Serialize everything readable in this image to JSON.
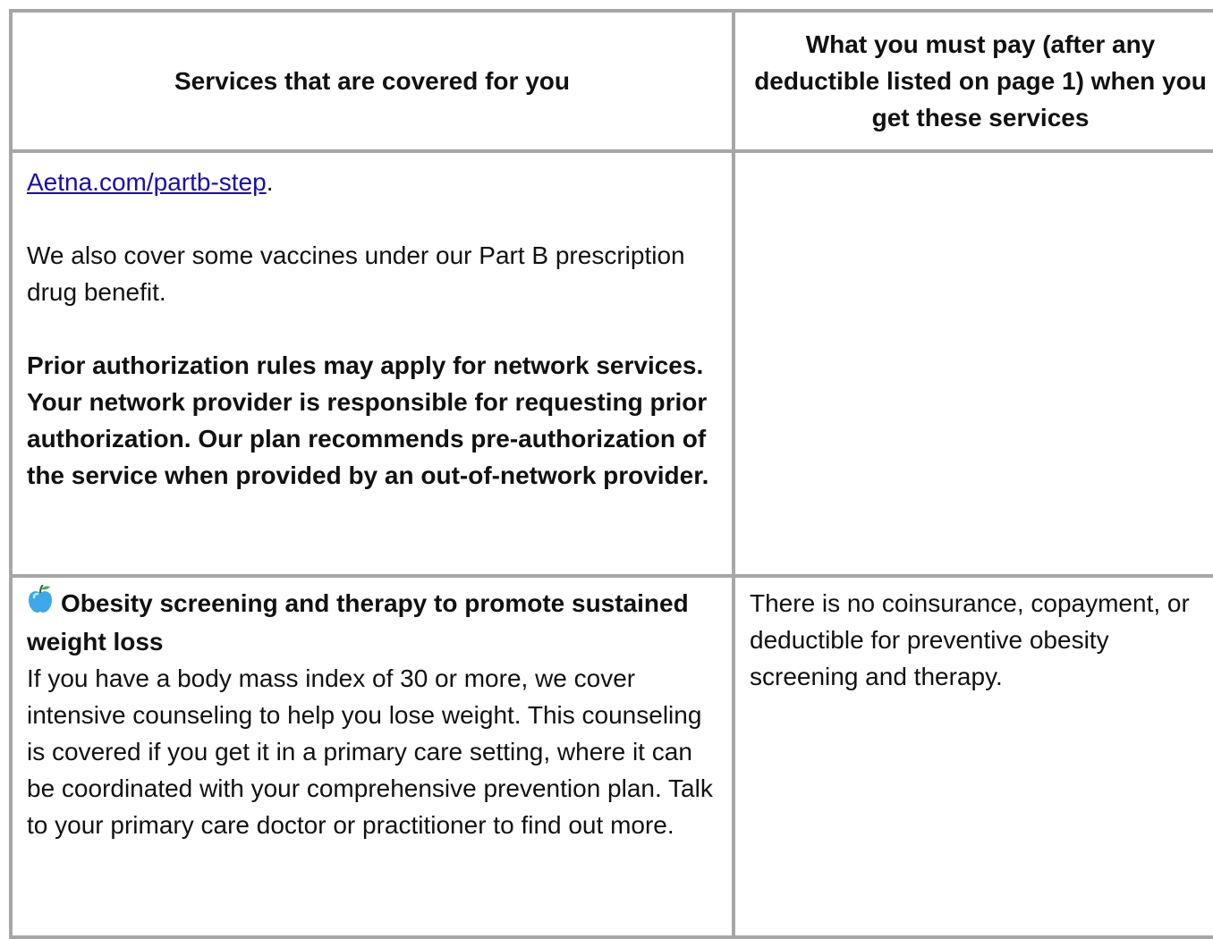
{
  "table": {
    "header": {
      "left": "Services that are covered for you",
      "right": "What you must pay (after any deductible listed on page 1) when you get these services"
    },
    "row_a": {
      "link_text": "Aetna.com/partb-step",
      "link_suffix": ".",
      "paragraph_1": "We also cover some vaccines under our Part B prescription drug benefit.",
      "paragraph_2_bold": "Prior authorization rules may apply for network services. Your network provider is responsible for requesting prior authorization. Our plan recommends pre-authorization of the service when provided by an out-of-network provider.",
      "right": ""
    },
    "row_b": {
      "icon": "apple-icon",
      "title": "Obesity screening and therapy to promote sustained weight loss",
      "body": "If you have a body mass index of 30 or more, we cover intensive counseling to help you lose weight. This counseling is covered if you get it in a primary care setting, where it can be coordinated with your comprehensive prevention plan. Talk to your primary care doctor or practitioner to find out more.",
      "right": "There is no coinsurance, copayment, or deductible for preventive obesity screening and therapy."
    }
  },
  "colors": {
    "border": "#a6a6a6",
    "link": "#1a0dab",
    "apple": "#3ea8e8"
  }
}
